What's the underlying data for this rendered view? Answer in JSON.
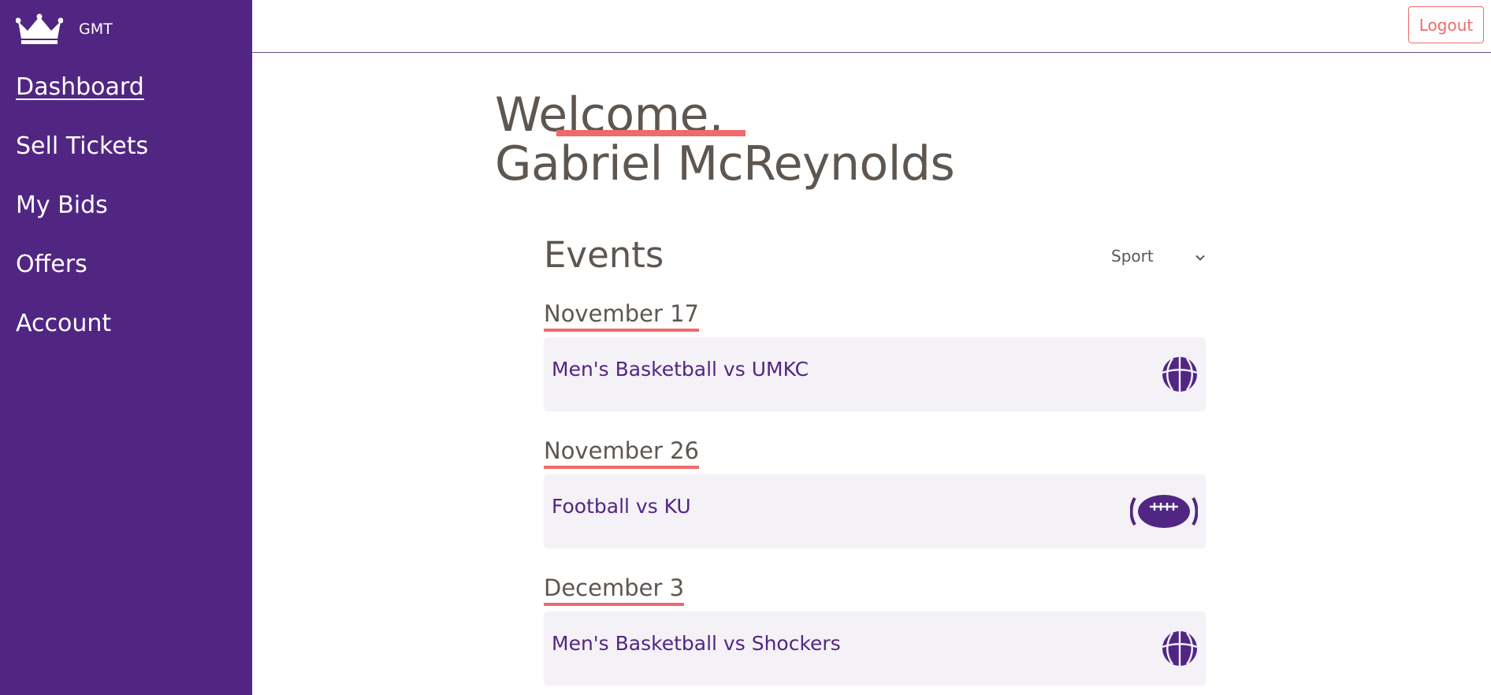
{
  "app": {
    "brand": "GMT"
  },
  "sidebar": {
    "items": [
      {
        "label": "Dashboard",
        "active": true
      },
      {
        "label": "Sell Tickets"
      },
      {
        "label": "My Bids"
      },
      {
        "label": "Offers"
      },
      {
        "label": "Account"
      }
    ]
  },
  "header": {
    "logout_label": "Logout"
  },
  "main": {
    "welcome_line1": "Welcome,",
    "welcome_line2": "Gabriel McReynolds",
    "events_title": "Events",
    "filter": {
      "selected": "Sport"
    },
    "events": [
      {
        "date": "November 17",
        "name": "Men's Basketball vs UMKC",
        "icon": "basketball-icon"
      },
      {
        "date": "November 26",
        "name": "Football vs KU",
        "icon": "football-icon"
      },
      {
        "date": "December 3",
        "name": "Men's Basketball vs Shockers",
        "icon": "basketball-icon"
      }
    ]
  },
  "colors": {
    "sidebar_bg": "#512683",
    "accent": "#f06a6a",
    "text_primary": "#5e5650",
    "event_text": "#512683",
    "card_bg": "#f4f1f7"
  }
}
